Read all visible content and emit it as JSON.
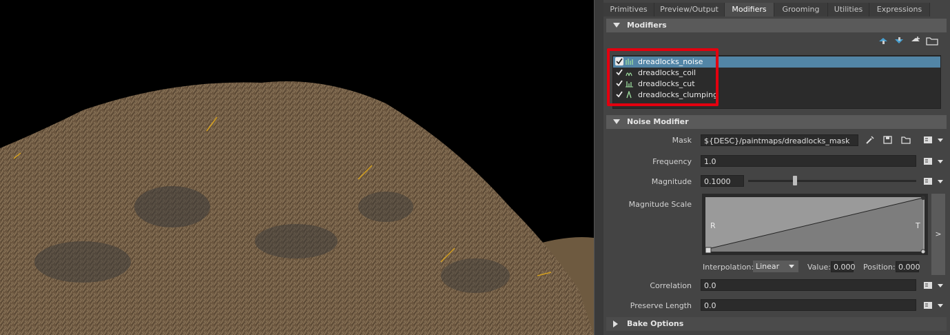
{
  "tabs": [
    {
      "label": "Primitives"
    },
    {
      "label": "Preview/Output"
    },
    {
      "label": "Modifiers"
    },
    {
      "label": "Grooming"
    },
    {
      "label": "Utilities"
    },
    {
      "label": "Expressions"
    }
  ],
  "active_tab": "Modifiers",
  "modifiers_section": {
    "title": "Modifiers",
    "items": [
      {
        "label": "dreadlocks_noise",
        "checked": true,
        "selected": true
      },
      {
        "label": "dreadlocks_coil",
        "checked": true,
        "selected": false
      },
      {
        "label": "dreadlocks_cut",
        "checked": true,
        "selected": false
      },
      {
        "label": "dreadlocks_clumping",
        "checked": true,
        "selected": false
      }
    ]
  },
  "noise_modifier": {
    "title": "Noise Modifier",
    "mask": {
      "label": "Mask",
      "value": "${DESC}/paintmaps/dreadlocks_mask"
    },
    "frequency": {
      "label": "Frequency",
      "value": "1.0"
    },
    "magnitude": {
      "label": "Magnitude",
      "value": "0.1000",
      "slider_fraction": 0.28
    },
    "magnitude_scale": {
      "label": "Magnitude Scale",
      "left_label": "R",
      "right_label": "T",
      "side_button": ">",
      "interpolation_label": "Interpolation:",
      "interpolation_value": "Linear",
      "value_label": "Value:",
      "value": "0.000",
      "position_label": "Position:",
      "position": "0.000"
    },
    "correlation": {
      "label": "Correlation",
      "value": "0.0"
    },
    "preserve_length": {
      "label": "Preserve Length",
      "value": "0.0"
    }
  },
  "bake_options": {
    "title": "Bake Options"
  },
  "colors": {
    "accent_selection": "#5285a6",
    "highlight_box": "#e3000f",
    "fur": "#8c7356"
  }
}
